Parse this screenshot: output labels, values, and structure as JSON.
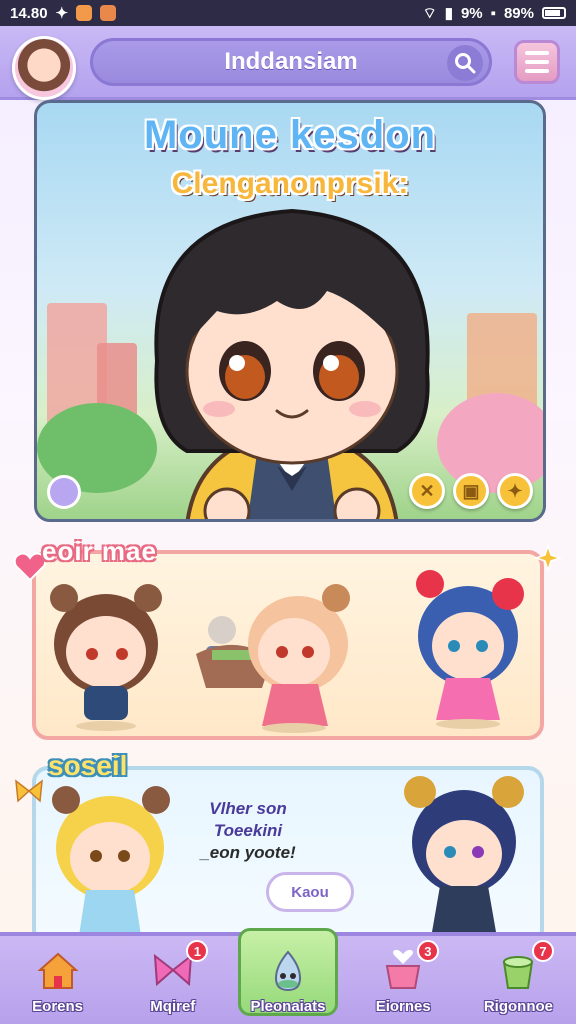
{
  "status_bar": {
    "time": "14.80",
    "signal": "9%",
    "battery": "89%"
  },
  "header": {
    "search_text": "Inddansiam",
    "icons": [
      "avatar",
      "search-icon",
      "menu-icon"
    ]
  },
  "hero": {
    "title": "Moune kesdon",
    "subtitle": "Clenganonprsik:"
  },
  "section1": {
    "title": "eoir mae"
  },
  "section2": {
    "title": "soseil",
    "message": [
      "Vlher son",
      "Toeekini",
      "_eon yoote!"
    ],
    "bubble": "Kaou"
  },
  "nav": {
    "items": [
      {
        "label": "Eorens",
        "icon": "house-icon",
        "badge": ""
      },
      {
        "label": "Mqiref",
        "icon": "bow-icon",
        "badge": "1"
      },
      {
        "label": "Pleonaiats",
        "icon": "pet-icon",
        "badge": ""
      },
      {
        "label": "Eiornes",
        "icon": "heart-basket-icon",
        "badge": "3"
      },
      {
        "label": "Rigonnoe",
        "icon": "cup-icon",
        "badge": "7"
      }
    ]
  },
  "colors": {
    "accent": "#b4a2ee",
    "active_tab": "#96d97a",
    "badge": "#e8344a"
  }
}
